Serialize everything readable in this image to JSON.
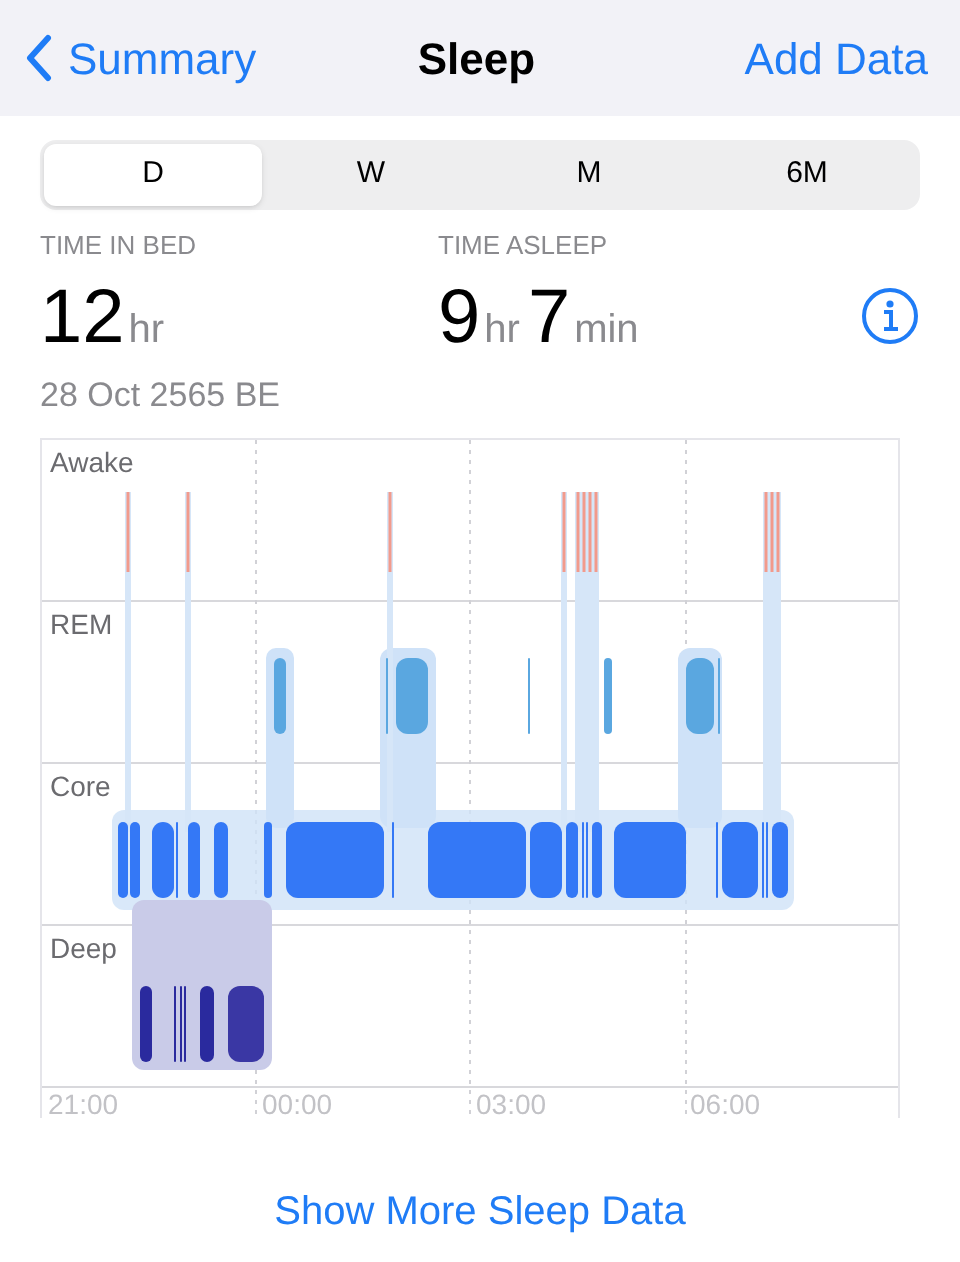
{
  "nav": {
    "back": "Summary",
    "title": "Sleep",
    "action": "Add Data"
  },
  "periods": [
    {
      "label": "D",
      "selected": true
    },
    {
      "label": "W",
      "selected": false
    },
    {
      "label": "M",
      "selected": false
    },
    {
      "label": "6M",
      "selected": false
    }
  ],
  "stats": [
    {
      "label": "TIME IN BED",
      "parts": [
        {
          "value": "12",
          "unit": "hr"
        }
      ]
    },
    {
      "label": "TIME ASLEEP",
      "parts": [
        {
          "value": "9",
          "unit": "hr"
        },
        {
          "value": "7",
          "unit": "min"
        }
      ]
    }
  ],
  "date": "28 Oct 2565 BE",
  "chart": {
    "stages": [
      "Awake",
      "REM",
      "Core",
      "Deep"
    ],
    "times": [
      "21:00",
      "00:00",
      "03:00",
      "06:00"
    ]
  },
  "footer_link": "Show More Sleep Data"
}
